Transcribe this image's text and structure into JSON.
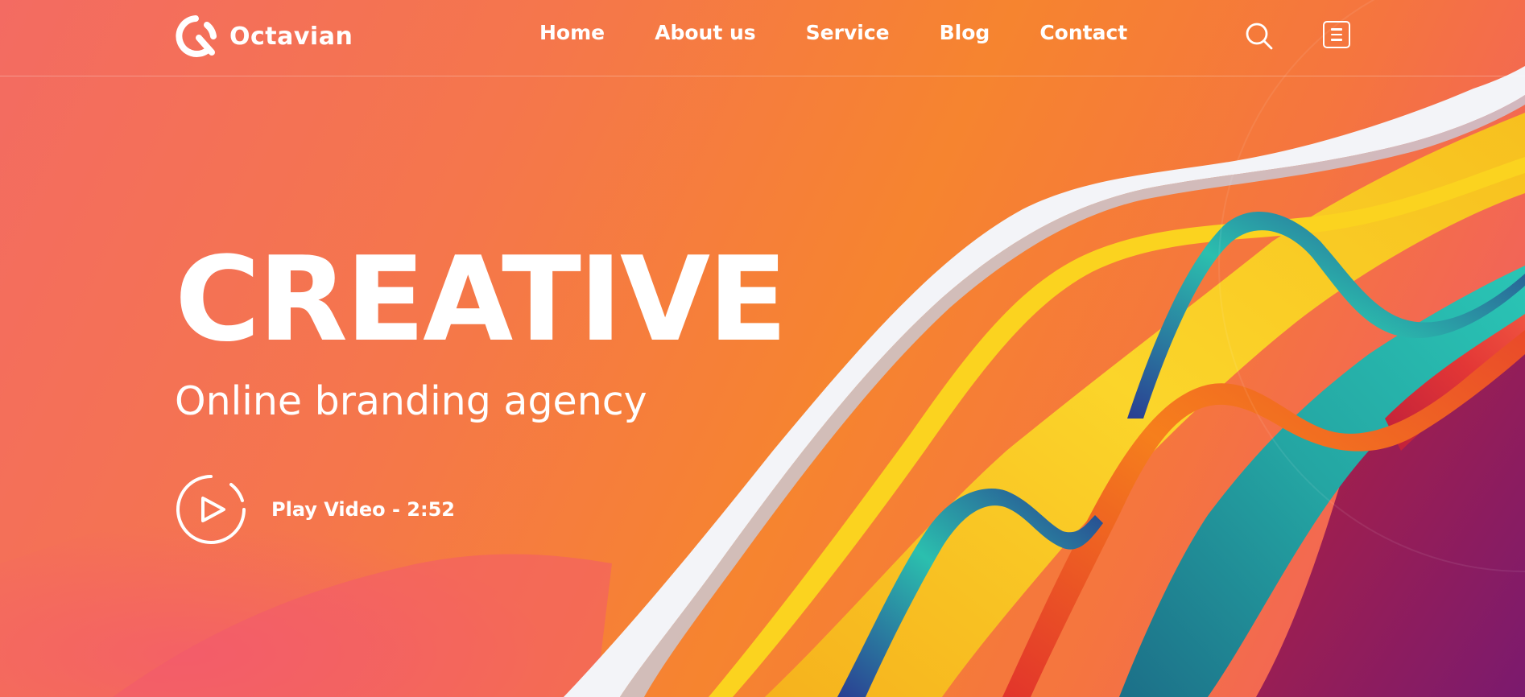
{
  "brand": {
    "name": "Octavian",
    "logo_icon": "q-logo-icon"
  },
  "nav": {
    "items": [
      {
        "label": "Home"
      },
      {
        "label": "About us"
      },
      {
        "label": "Service"
      },
      {
        "label": "Blog"
      },
      {
        "label": "Contact"
      }
    ],
    "search_icon": "search-icon",
    "menu_icon": "menu-icon"
  },
  "hero": {
    "title": "CREATIVE",
    "subtitle": "Online branding agency",
    "play_label": "Play Video - 2:52",
    "play_icon": "play-icon"
  },
  "colors": {
    "background_start": "#f36b62",
    "background_mid": "#f6842f",
    "background_end": "#f0586a",
    "text": "#ffffff",
    "ribbon_yellow": "#f7c51e",
    "ribbon_teal": "#2bb6a6",
    "ribbon_red": "#e2323a",
    "ribbon_navy": "#233a8a",
    "ribbon_white": "#f3f4f8"
  }
}
